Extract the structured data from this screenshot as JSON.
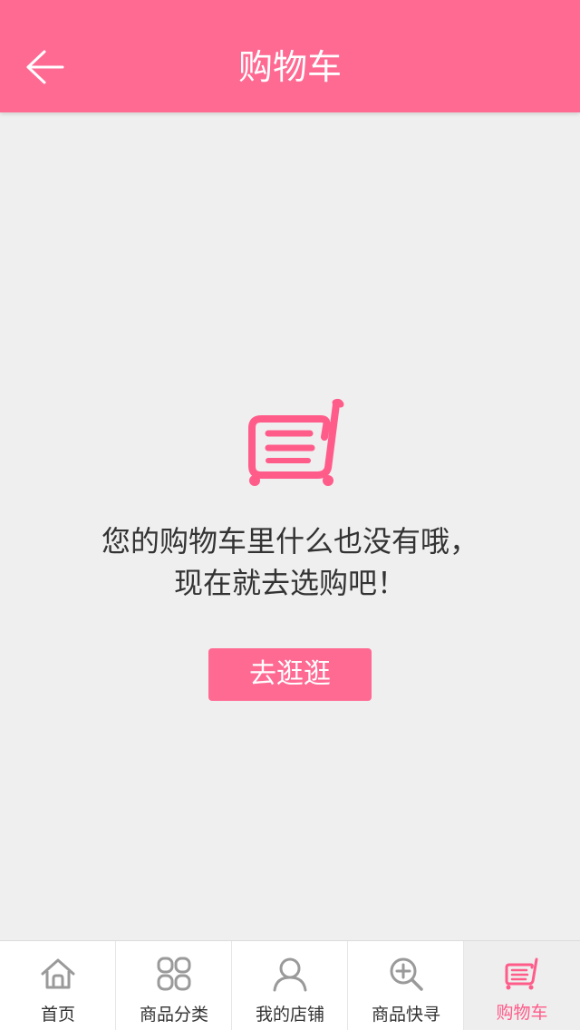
{
  "header": {
    "title": "购物车"
  },
  "empty_state": {
    "line1": "您的购物车里什么也没有哦，",
    "line2": "现在就去选购吧！",
    "button_label": "去逛逛"
  },
  "tabbar": {
    "tabs": [
      {
        "label": "首页",
        "icon": "home-icon",
        "active": false
      },
      {
        "label": "商品分类",
        "icon": "category-grid-icon",
        "active": false
      },
      {
        "label": "我的店铺",
        "icon": "user-icon",
        "active": false
      },
      {
        "label": "商品快寻",
        "icon": "search-plus-icon",
        "active": false
      },
      {
        "label": "购物车",
        "icon": "cart-icon",
        "active": true
      }
    ]
  },
  "colors": {
    "primary": "#ff6a93",
    "active_text": "#ff5c8a",
    "icon_gray": "#9a9a9a"
  }
}
